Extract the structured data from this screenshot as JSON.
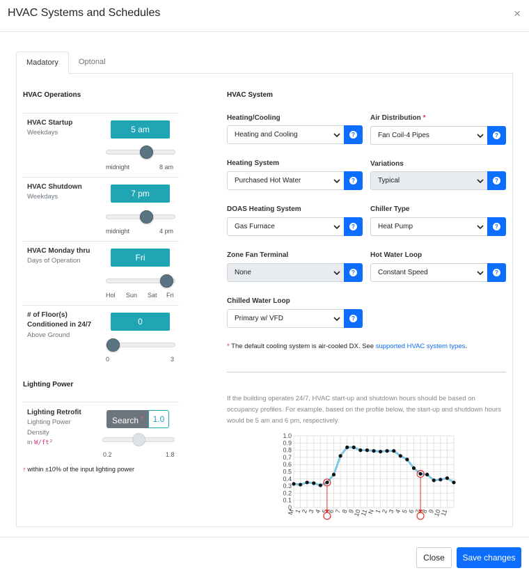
{
  "dialog": {
    "title": "HVAC Systems and Schedules",
    "close_glyph": "×"
  },
  "tabs": [
    {
      "label": "Madatory",
      "active": true
    },
    {
      "label": "Optonal",
      "active": false
    }
  ],
  "operations": {
    "heading": "HVAC Operations",
    "rows": [
      {
        "label": "HVAC Startup",
        "sub": "Weekdays",
        "value": "5 am",
        "min": "midnight",
        "max": "8 am",
        "level": 0.62
      },
      {
        "label": "HVAC Shutdown",
        "sub": "Weekdays",
        "value": "7 pm",
        "min": "midnight",
        "max": "4 pm",
        "level": 0.6
      },
      {
        "label": "HVAC Monday thru",
        "sub": "Days of Operation",
        "value": "Fri",
        "ticks": [
          "Hol",
          "Sun",
          "Sat",
          "Fri"
        ],
        "level": 1.0
      },
      {
        "label_line1": "# of Floor(s)",
        "label_line2": "Conditioned in 24/7",
        "sub": "Above Ground",
        "value": "0",
        "min": "0",
        "max": "3",
        "level": 0.0
      }
    ]
  },
  "lighting": {
    "heading": "Lighting Power",
    "label": "Lighting Retrofit",
    "sub1": "Lighting Power",
    "sub2": "Density",
    "unit_prefix": "in",
    "unit": "W/ft²",
    "search_label": "Search",
    "search_mark": "†",
    "value": "1.0",
    "min": "0.2",
    "max": "1.8",
    "level": 0.5,
    "footnote_mark": "†",
    "footnote": "within ±10% of the input lighting power"
  },
  "system": {
    "heading": "HVAC System",
    "fields": {
      "heating_cooling": {
        "label": "Heating/Cooling",
        "value": "Heating and Cooling"
      },
      "air_distribution": {
        "label": "Air Distribution",
        "required": "*",
        "value": "Fan Coil-4 Pipes"
      },
      "heating_system": {
        "label": "Heating System",
        "value": "Purchased Hot Water"
      },
      "variations": {
        "label": "Variations",
        "value": "Typical"
      },
      "doas_heating": {
        "label": "DOAS Heating System",
        "value": "Gas Furnace"
      },
      "chiller_type": {
        "label": "Chiller Type",
        "value": "Heat Pump"
      },
      "zone_fan": {
        "label": "Zone Fan Terminal",
        "value": "None"
      },
      "hot_water_loop": {
        "label": "Hot Water Loop",
        "value": "Constant Speed"
      },
      "chilled_water_loop": {
        "label": "Chilled Water Loop",
        "value": "Primary w/ VFD"
      }
    },
    "help_glyph": "?",
    "note_mark": "*",
    "note_text": "The default cooling system is air-cooled DX. See",
    "note_link": "supported HVAC system types",
    "note_end": ".",
    "paragraph": "If the building operates 24/7, HVAC start-up and shutdown hours should be based on occupancy profiles. For example, based on the profile below, the start-up and shutdown hours would be 5 am and 6 pm, respectively."
  },
  "chart_data": {
    "type": "line",
    "x": [
      "M",
      "1",
      "2",
      "3",
      "4",
      "5",
      "6",
      "7",
      "8",
      "9",
      "10",
      "11",
      "N",
      "1",
      "2",
      "3",
      "4",
      "5",
      "6",
      "7",
      "8",
      "9",
      "10",
      "11"
    ],
    "values": [
      0.33,
      0.32,
      0.35,
      0.34,
      0.31,
      0.35,
      0.46,
      0.72,
      0.84,
      0.84,
      0.8,
      0.8,
      0.79,
      0.78,
      0.79,
      0.79,
      0.72,
      0.67,
      0.55,
      0.47,
      0.46,
      0.38,
      0.39,
      0.41,
      0.35
    ],
    "yticks": [
      "0",
      "0.1",
      "0.2",
      "0.3",
      "0.4",
      "0.5",
      "0.6",
      "0.7",
      "0.8",
      "0.9",
      "1.0"
    ],
    "ylim": [
      0,
      1.0
    ],
    "grid": true,
    "line_color": "#7ec8e3",
    "marker_color": "#111111",
    "highlight_indices": [
      5,
      19
    ],
    "highlight_color": "#dd3333"
  },
  "footer": {
    "close_label": "Close",
    "save_label": "Save changes"
  }
}
